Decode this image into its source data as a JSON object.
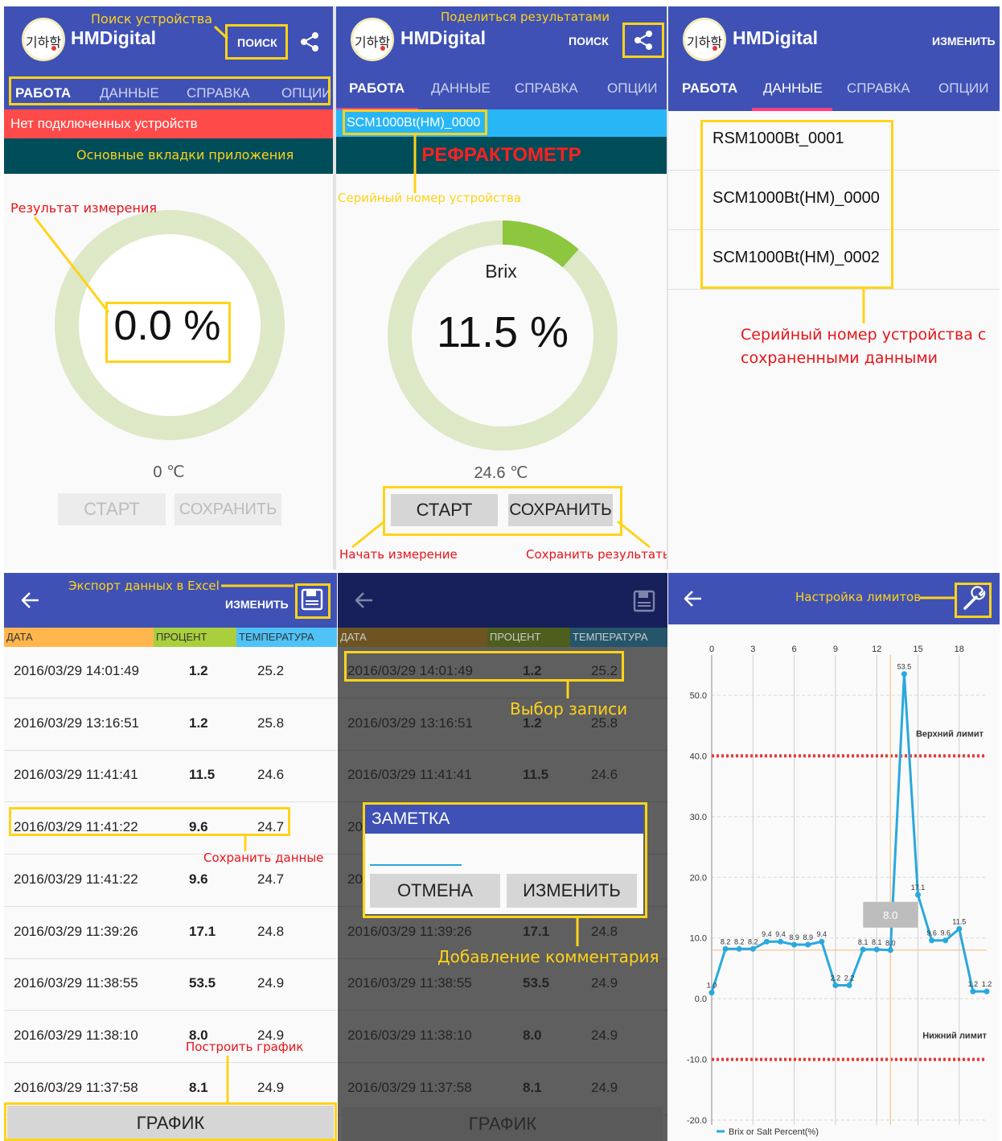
{
  "app": {
    "brand": "HMDigital",
    "logo_text": "기하학",
    "search_label": "ПОИСК",
    "edit_label": "ИЗМЕНИТЬ",
    "tabs": [
      "РАБОТА",
      "ДАННЫЕ",
      "СПРАВКА",
      "ОПЦИИ"
    ]
  },
  "panel1": {
    "status": "Нет подключенных устройств",
    "value": "0.0 %",
    "temperature": "0 ℃",
    "start": "СТАРТ",
    "save": "СОХРАНИТЬ",
    "notes": {
      "search": "Поиск устройства",
      "tabs": "Основные вкладки приложения",
      "result": "Результат измерения"
    }
  },
  "panel2": {
    "serial": "SCM1000Bt(HM)_0000",
    "device_type": "РЕФРАКТОМЕТР",
    "unit": "Brix",
    "value": "11.5 %",
    "gauge_fraction": 0.115,
    "temperature": "24.6 ℃",
    "start": "СТАРТ",
    "save": "СОХРАНИТЬ",
    "notes": {
      "share": "Поделиться результатами",
      "serial": "Серийный номер устройства",
      "start": "Начать измерение",
      "save": "Сохранить результаты"
    }
  },
  "panel3": {
    "devices": [
      "RSM1000Bt_0001",
      "SCM1000Bt(HM)_0000",
      "SCM1000Bt(HM)_0002"
    ],
    "notes": {
      "serial_1": "Серийный номер устройства с",
      "serial_2": "сохраненными данными"
    }
  },
  "table": {
    "headers": [
      "ДАТА",
      "ПРОЦЕНТ",
      "ТЕМПЕРАТУРА"
    ],
    "rows": [
      {
        "date": "2016/03/29 14:01:49",
        "pct": "1.2",
        "temp": "25.2"
      },
      {
        "date": "2016/03/29 13:16:51",
        "pct": "1.2",
        "temp": "25.8"
      },
      {
        "date": "2016/03/29 11:41:41",
        "pct": "11.5",
        "temp": "24.6"
      },
      {
        "date": "2016/03/29 11:41:22",
        "pct": "9.6",
        "temp": "24.7"
      },
      {
        "date": "2016/03/29 11:41:22",
        "pct": "9.6",
        "temp": "24.7"
      },
      {
        "date": "2016/03/29 11:39:26",
        "pct": "17.1",
        "temp": "24.8"
      },
      {
        "date": "2016/03/29 11:38:55",
        "pct": "53.5",
        "temp": "24.9"
      },
      {
        "date": "2016/03/29 11:38:10",
        "pct": "8.0",
        "temp": "24.9"
      },
      {
        "date": "2016/03/29 11:37:58",
        "pct": "8.1",
        "temp": "24.9"
      }
    ],
    "graph_button": "ГРАФИК"
  },
  "panel4": {
    "notes": {
      "export": "Экспорт данных в Excel",
      "save_data": "Сохранить данные",
      "graph": "Построить график"
    }
  },
  "panel5": {
    "dialog_title": "ЗАМЕТКА",
    "cancel": "ОТМЕНА",
    "change": "ИЗМЕНИТЬ",
    "notes": {
      "select": "Выбор записи",
      "comment": "Добавление комментария"
    }
  },
  "panel6": {
    "notes": {
      "limits": "Настройка лимитов"
    }
  },
  "chart_data": {
    "type": "line",
    "x_ticks": [
      "0",
      "3",
      "6",
      "9",
      "12",
      "15",
      "18"
    ],
    "y_ticks": [
      "50.0",
      "40.0",
      "30.0",
      "20.0",
      "10.0",
      "0.0",
      "-10.0",
      "-20.0"
    ],
    "ylim": [
      -20,
      50
    ],
    "xlim": [
      0,
      20
    ],
    "grid": true,
    "series": [
      {
        "name": "Brix or Salt Percent(%)",
        "color": "#29a8dd",
        "x": [
          0,
          1,
          2,
          3,
          4,
          5,
          6,
          7,
          8,
          9,
          10,
          11,
          12,
          13,
          14,
          15,
          16,
          17,
          18,
          19,
          20
        ],
        "values": [
          1.0,
          8.2,
          8.2,
          8.2,
          9.4,
          9.4,
          8.9,
          8.9,
          9.4,
          2.2,
          2.2,
          8.1,
          8.1,
          8.0,
          53.5,
          17.1,
          9.6,
          9.6,
          11.5,
          1.2,
          1.2
        ],
        "labels": [
          "1.0",
          "8.2",
          "8.2",
          "8.2",
          "9.4",
          "9.4",
          "8.9",
          "8.9",
          "9.4",
          "2.2",
          "2.2",
          "8.1",
          "8.1",
          "8.0",
          "53.5",
          "17.1",
          "9.6",
          "9.6",
          "11.5",
          "1.2",
          "1.2"
        ]
      }
    ],
    "upper_limit": {
      "value": 40,
      "label": "Верхний лимит",
      "color": "#e53935"
    },
    "lower_limit": {
      "value": -10,
      "label": "Нижний лимит",
      "color": "#e53935"
    },
    "highlight": {
      "x": 13,
      "value": 8.0,
      "label": "8.0",
      "color": "#f5c28a"
    },
    "legend": "bottom-left"
  }
}
